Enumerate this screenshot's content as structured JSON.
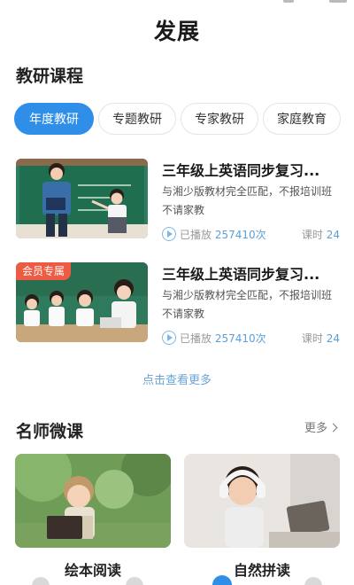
{
  "header": {
    "title": "发展"
  },
  "research": {
    "title": "教研课程",
    "tabs": [
      {
        "label": "年度教研",
        "active": true
      },
      {
        "label": "专题教研",
        "active": false
      },
      {
        "label": "专家教研",
        "active": false
      },
      {
        "label": "家庭教育",
        "active": false
      }
    ],
    "courses": [
      {
        "title": "三年级上英语同步复习...",
        "desc": "与湘少版教材完全匹配，不报培训班不请家教",
        "played_label": "已播放",
        "played_count": "257410次",
        "lessons_label": "课时",
        "lessons_count": "24",
        "badge": ""
      },
      {
        "title": "三年级上英语同步复习...",
        "desc": "与湘少版教材完全匹配，不报培训班不请家教",
        "played_label": "已播放",
        "played_count": "257410次",
        "lessons_label": "课时",
        "lessons_count": "24",
        "badge": "会员专属"
      }
    ],
    "more_label": "点击查看更多"
  },
  "teachers": {
    "title": "名师微课",
    "more_label": "更多",
    "cards": [
      {
        "title": "绘本阅读"
      },
      {
        "title": "自然拼读"
      }
    ]
  },
  "colors": {
    "accent": "#2f8fe8",
    "badge": "#ee5b42",
    "link": "#6aa3d8"
  }
}
